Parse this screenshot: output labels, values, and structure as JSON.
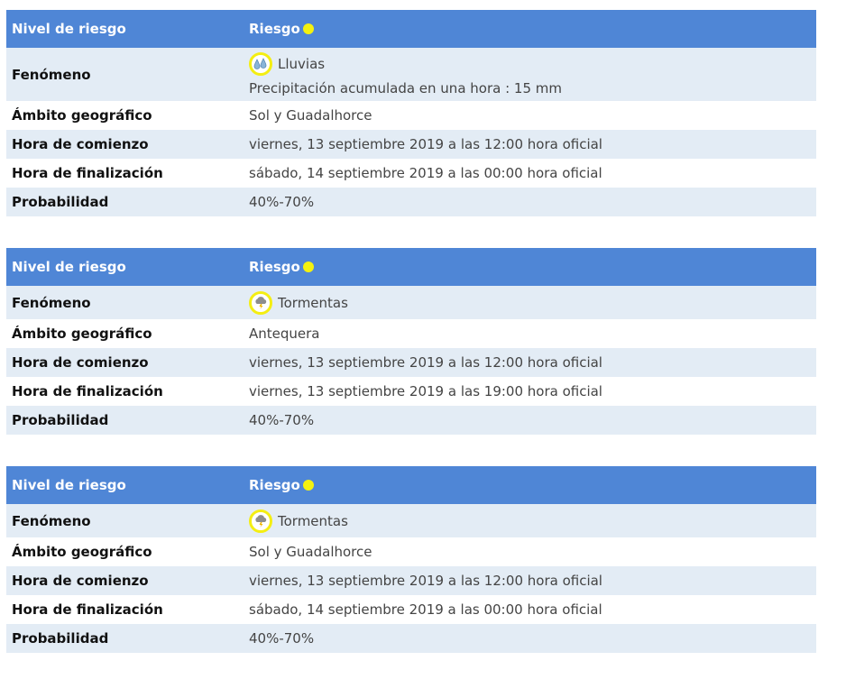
{
  "colors": {
    "header": "#4f86d6",
    "row_alt": "#e3ecf5",
    "level_yellow": "#f4f20f"
  },
  "warnings": [
    {
      "nivel_label": "Nivel de riesgo",
      "riesgo_label": "Riesgo",
      "fenomeno_label": "Fenómeno",
      "fenomeno_icon": "rain-drops-icon",
      "fenomeno": "Lluvias",
      "detalle": "Precipitación acumulada en una hora : 15 mm",
      "ambito_label": "Ámbito geográfico",
      "ambito": "Sol y Guadalhorce",
      "comienzo_label": "Hora de comienzo",
      "comienzo": "viernes, 13 septiembre 2019 a las 12:00 hora oficial",
      "fin_label": "Hora de finalización",
      "fin": "sábado, 14 septiembre 2019 a las 00:00 hora oficial",
      "prob_label": "Probabilidad",
      "prob": "40%-70%"
    },
    {
      "nivel_label": "Nivel de riesgo",
      "riesgo_label": "Riesgo",
      "fenomeno_label": "Fenómeno",
      "fenomeno_icon": "storm-cloud-icon",
      "fenomeno": "Tormentas",
      "ambito_label": "Ámbito geográfico",
      "ambito": "Antequera",
      "comienzo_label": "Hora de comienzo",
      "comienzo": "viernes, 13 septiembre 2019 a las 12:00 hora oficial",
      "fin_label": "Hora de finalización",
      "fin": "viernes, 13 septiembre 2019 a las 19:00 hora oficial",
      "prob_label": "Probabilidad",
      "prob": "40%-70%"
    },
    {
      "nivel_label": "Nivel de riesgo",
      "riesgo_label": "Riesgo",
      "fenomeno_label": "Fenómeno",
      "fenomeno_icon": "storm-cloud-icon",
      "fenomeno": "Tormentas",
      "ambito_label": "Ámbito geográfico",
      "ambito": "Sol y Guadalhorce",
      "comienzo_label": "Hora de comienzo",
      "comienzo": "viernes, 13 septiembre 2019 a las 12:00 hora oficial",
      "fin_label": "Hora de finalización",
      "fin": "sábado, 14 septiembre 2019 a las 00:00 hora oficial",
      "prob_label": "Probabilidad",
      "prob": "40%-70%"
    }
  ]
}
